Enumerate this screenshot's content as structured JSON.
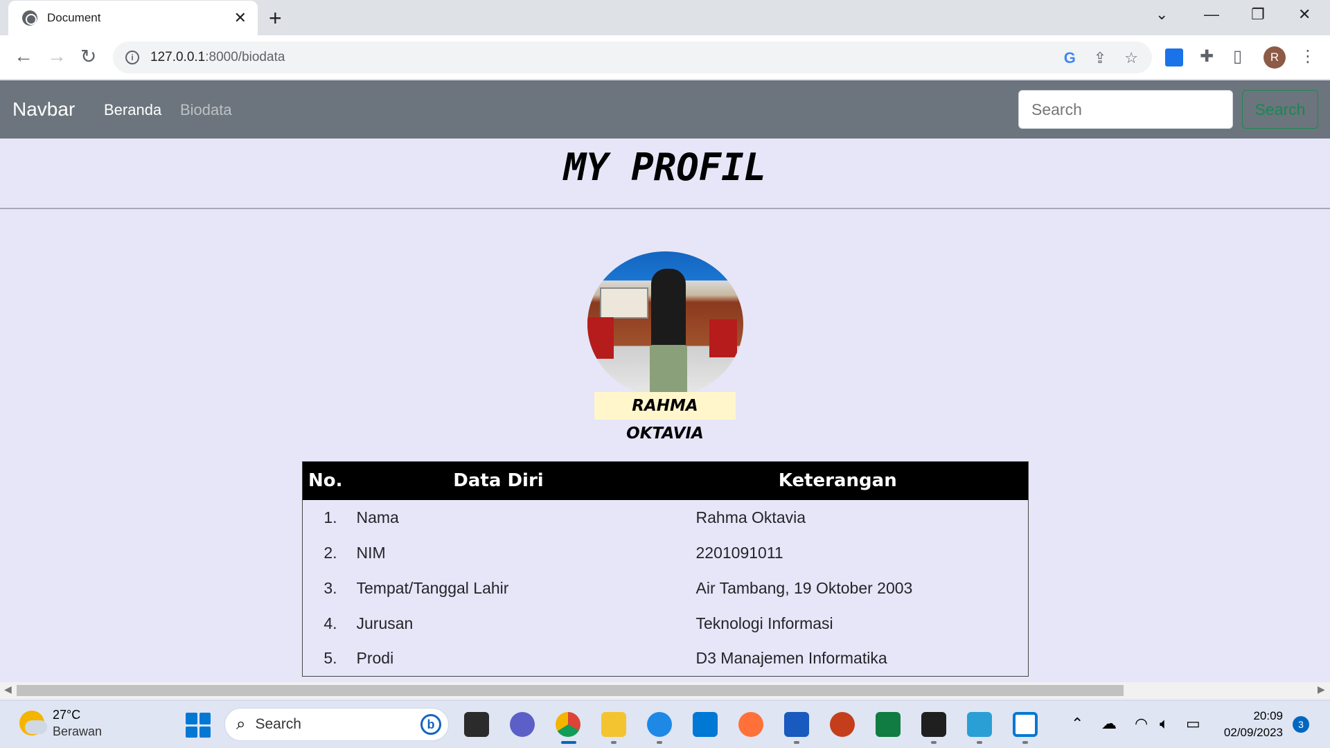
{
  "browser": {
    "tab_title": "Document",
    "close_tab": "✕",
    "new_tab": "+",
    "url_host": "127.0.0.1",
    "url_path": ":8000/biodata",
    "profile_initial": "R"
  },
  "navbar": {
    "brand": "Navbar",
    "links": [
      "Beranda",
      "Biodata"
    ],
    "search_placeholder": "Search",
    "search_button": "Search"
  },
  "page": {
    "title": "MY PROFIL",
    "name": "RAHMA OKTAVIA"
  },
  "table": {
    "headers": [
      "No.",
      "Data Diri",
      "Keterangan"
    ],
    "rows": [
      {
        "no": "1.",
        "field": "Nama",
        "value": "Rahma Oktavia"
      },
      {
        "no": "2.",
        "field": "NIM",
        "value": "2201091011"
      },
      {
        "no": "3.",
        "field": "Tempat/Tanggal Lahir",
        "value": "Air Tambang, 19 Oktober 2003"
      },
      {
        "no": "4.",
        "field": "Jurusan",
        "value": "Teknologi Informasi"
      },
      {
        "no": "5.",
        "field": "Prodi",
        "value": "D3 Manajemen Informatika"
      }
    ]
  },
  "taskbar": {
    "weather_temp": "27°C",
    "weather_desc": "Berawan",
    "search_label": "Search",
    "time": "20:09",
    "date": "02/09/2023",
    "notifications": "3"
  },
  "colors": {
    "page_bg": "#e6e6f8",
    "navbar_bg": "#6c757d",
    "search_button": "#198754",
    "name_badge_bg": "#fff6cc"
  }
}
